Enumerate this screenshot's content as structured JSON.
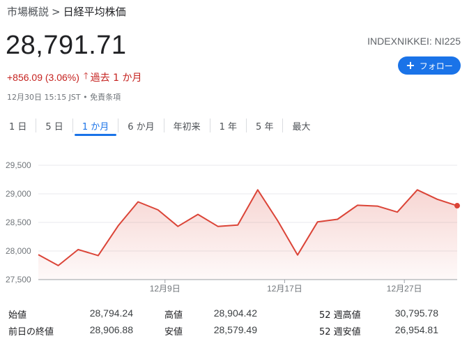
{
  "breadcrumb": {
    "parent": "市場概説",
    "separator": ">",
    "current": "日経平均株価"
  },
  "quote": {
    "price": "28,791.71",
    "symbol": "INDEXNIKKEI: NI225",
    "change": "+856.09 (3.06%)",
    "change_arrow": "🡑",
    "period_label": "過去 1 か月",
    "timestamp": "12月30日 15:15 JST • 免責条項",
    "follow_label": "フォロー",
    "follow_icon": "plus-icon"
  },
  "tabs": [
    {
      "label": "1 日",
      "active": false
    },
    {
      "label": "5 日",
      "active": false
    },
    {
      "label": "1 か月",
      "active": true
    },
    {
      "label": "6 か月",
      "active": false
    },
    {
      "label": "年初来",
      "active": false
    },
    {
      "label": "1 年",
      "active": false
    },
    {
      "label": "5 年",
      "active": false
    },
    {
      "label": "最大",
      "active": false
    }
  ],
  "colors": {
    "accent": "#1a73e8",
    "down_red": "#c5221f",
    "line": "#db4437"
  },
  "chart_data": {
    "type": "area",
    "ylim": [
      27500,
      29500
    ],
    "yticks": [
      27500,
      28000,
      28500,
      29000,
      29500
    ],
    "ytick_labels": [
      "27,500",
      "28,000",
      "28,500",
      "29,000",
      "29,500"
    ],
    "xtick_labels": [
      {
        "label": "12月9日",
        "index": 6.35
      },
      {
        "label": "12月17日",
        "index": 12.35
      },
      {
        "label": "12月27日",
        "index": 18.35
      }
    ],
    "values": [
      27935,
      27745,
      28025,
      27920,
      28440,
      28860,
      28720,
      28430,
      28640,
      28430,
      28455,
      29070,
      28530,
      27930,
      28510,
      28555,
      28800,
      28785,
      28680,
      29070,
      28905,
      28792
    ],
    "grid": true
  },
  "stats": [
    [
      {
        "label": "始値",
        "value": "28,794.24"
      },
      {
        "label": "高値",
        "value": "28,904.42"
      },
      {
        "label": "52 週高値",
        "value": "30,795.78"
      }
    ],
    [
      {
        "label": "前日の終値",
        "value": "28,906.88"
      },
      {
        "label": "安値",
        "value": "28,579.49"
      },
      {
        "label": "52 週安値",
        "value": "26,954.81"
      }
    ]
  ]
}
